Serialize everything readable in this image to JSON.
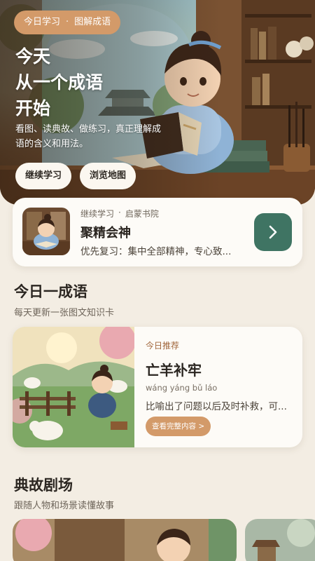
{
  "hero": {
    "tag_part1": "今日学习",
    "tag_sep": "·",
    "tag_part2": "图解成语",
    "title_line1": "今天",
    "title_line2": "从一个成语",
    "title_line3": "开始",
    "description": "看图、读典故、做练习，真正理解成语的含义和用法。",
    "button_continue": "继续学习",
    "button_map": "浏览地图"
  },
  "continue_card": {
    "meta_label": "继续学习",
    "meta_sep": "·",
    "meta_place": "启蒙书院",
    "title": "聚精会神",
    "subtitle": "优先复习：集中全部精神，专心致...",
    "arrow_icon": "chevron-right-icon"
  },
  "daily": {
    "section_title": "今日一成语",
    "section_subtitle": "每天更新一张图文知识卡",
    "label": "今日推荐",
    "idiom": "亡羊补牢",
    "pinyin": "wáng yáng bǔ láo",
    "description": "比喻出了问题以后及时补救，可...",
    "button": "查看完整内容 >"
  },
  "theater": {
    "section_title": "典故剧场",
    "section_subtitle": "跟随人物和场景读懂故事"
  },
  "colors": {
    "accent_orange": "#d39a69",
    "accent_green": "#3f7463",
    "background": "#f3ede3"
  }
}
